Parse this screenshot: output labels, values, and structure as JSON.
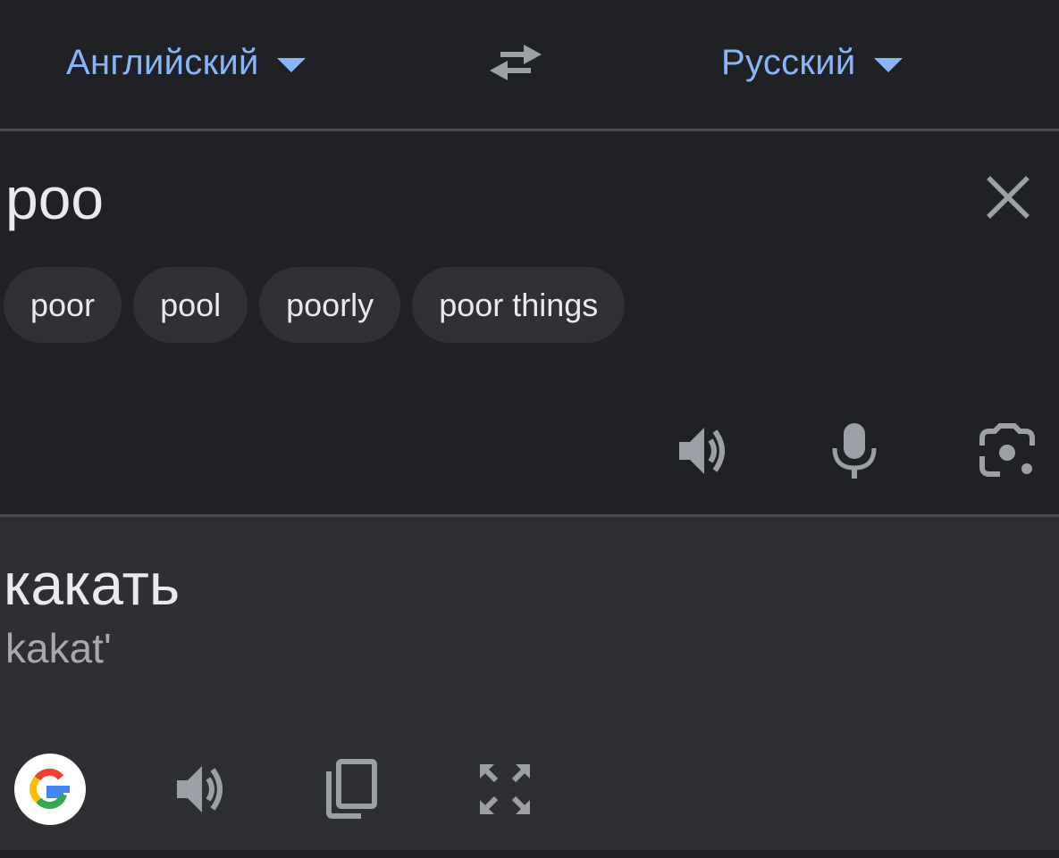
{
  "languages": {
    "source": "Английский",
    "target": "Русский"
  },
  "source": {
    "text": "poo",
    "suggestions": [
      "poor",
      "pool",
      "poorly",
      "poor things"
    ],
    "tools": [
      "speaker-icon",
      "microphone-icon",
      "camera-lens-icon"
    ]
  },
  "translation": {
    "text": "какать",
    "transliteration": "kakat'",
    "tools": [
      "google-logo",
      "speaker-icon",
      "copy-icon",
      "fullscreen-icon"
    ]
  },
  "colors": {
    "background": "#202124",
    "translation_panel": "#2e2f33",
    "chip": "#303134",
    "accent": "#8ab4f8",
    "text": "#e8eaed",
    "icon": "#9aa0a6"
  }
}
